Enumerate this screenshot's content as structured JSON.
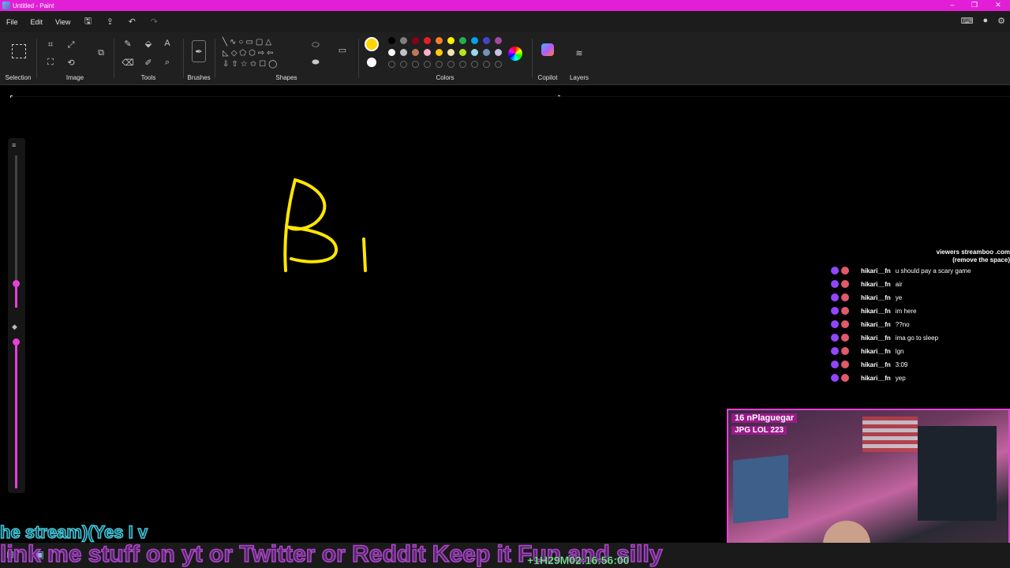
{
  "window": {
    "title": "Untitled - Paint"
  },
  "menu": {
    "file": "File",
    "edit": "Edit",
    "view": "View"
  },
  "ribbon": {
    "selection": "Selection",
    "image": "Image",
    "tools": "Tools",
    "brushes": "Brushes",
    "shapes": "Shapes",
    "colors": "Colors",
    "copilot": "Copilot",
    "layers": "Layers"
  },
  "colors": {
    "primary": "#ffd400",
    "secondary": "#ffffff",
    "palette_row1": [
      "#000000",
      "#7f7f7f",
      "#880015",
      "#ed1c24",
      "#ff7f27",
      "#fff200",
      "#22b14c",
      "#00a2e8",
      "#3f48cc",
      "#a349a4"
    ],
    "palette_row2": [
      "#ffffff",
      "#c3c3c3",
      "#b97a57",
      "#ffaec9",
      "#ffc90e",
      "#efe4b0",
      "#b5e61d",
      "#99d9ea",
      "#7092be",
      "#c8bfe7"
    ]
  },
  "chat": {
    "header_line1": "viewers streamboo .com",
    "header_line2": "(remove the space)",
    "messages": [
      {
        "user": "hikari__fn",
        "text": "u should pay a scary game"
      },
      {
        "user": "hikari__fn",
        "text": "air"
      },
      {
        "user": "hikari__fn",
        "text": "ye"
      },
      {
        "user": "hikari__fn",
        "text": "im here"
      },
      {
        "user": "hikari__fn",
        "text": "??no"
      },
      {
        "user": "hikari__fn",
        "text": "ima go to sleep"
      },
      {
        "user": "hikari__fn",
        "text": "lgn"
      },
      {
        "user": "hikari__fn",
        "text": "3:09"
      },
      {
        "user": "hikari__fn",
        "text": "yep"
      }
    ]
  },
  "webcam": {
    "tag1": "16 nPlaguegar",
    "tag2": "JPG LOL 223"
  },
  "overlay": {
    "line1": "he stream)(Yes I v",
    "line2": "link me stuff on yt or Twitter or Reddit Keep it Fun and silly",
    "timer": "+1H29M02:16:56:00"
  }
}
